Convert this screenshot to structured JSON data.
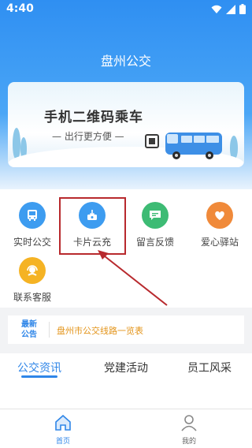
{
  "status": {
    "time": "4:40"
  },
  "header": {
    "title": "盘州公交"
  },
  "banner": {
    "headline": "手机二维码乘车",
    "subline": "— 出行更方便 —"
  },
  "grid": {
    "items": [
      {
        "label": "实时公交",
        "icon": "bus-icon",
        "color": "#3d9cf0"
      },
      {
        "label": "卡片云充",
        "icon": "card-recharge-icon",
        "color": "#3d9cf0"
      },
      {
        "label": "留言反馈",
        "icon": "message-icon",
        "color": "#3dbb74"
      },
      {
        "label": "爱心驿站",
        "icon": "heart-icon",
        "color": "#f08a3a"
      },
      {
        "label": "联系客服",
        "icon": "headset-icon",
        "color": "#f5b324"
      }
    ]
  },
  "notice": {
    "badge_line1": "最新",
    "badge_line2": "公告",
    "text": "盘州市公交线路一览表"
  },
  "tabs": [
    {
      "label": "公交资讯",
      "active": true
    },
    {
      "label": "党建活动",
      "active": false
    },
    {
      "label": "员工风采",
      "active": false
    }
  ],
  "bottom_nav": [
    {
      "label": "首页",
      "active": true
    },
    {
      "label": "我的",
      "active": false
    }
  ],
  "colors": {
    "accent": "#2f86e8",
    "highlight_border": "#b8292d",
    "notice_text": "#e3941a"
  }
}
